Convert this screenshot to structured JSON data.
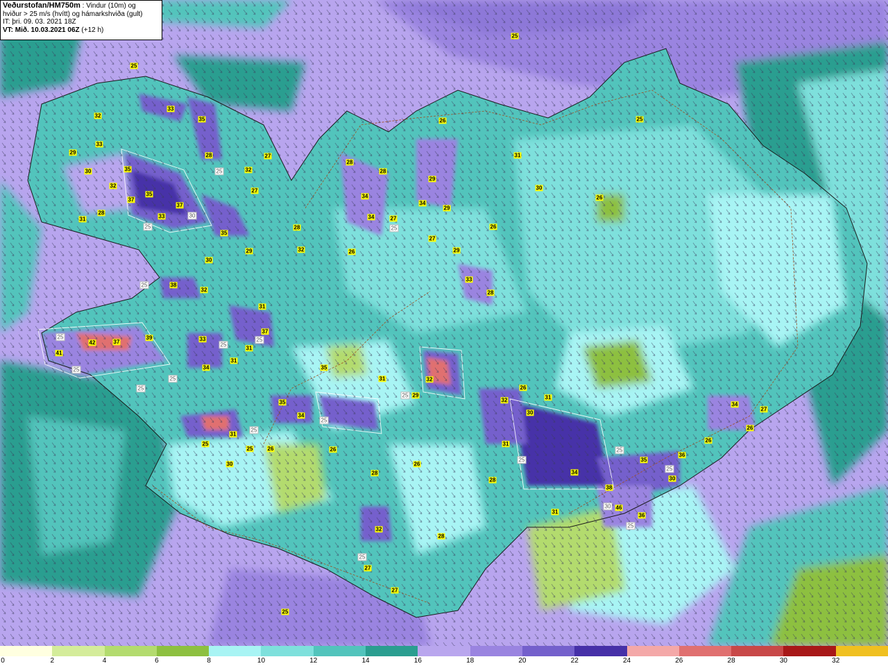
{
  "header": {
    "title": "Veðurstofan/HM750m",
    "subtitle_part1": " : Vindur (10m) og",
    "subtitle_part2": "hviður > 25 m/s (hvítt) og hámarkshviða (gult)",
    "it_line": "IT: þri. 09. 03. 2021 18Z",
    "vt_line": "VT: Mið. 10.03.2021 06Z",
    "vt_offset": " (+12 h)"
  },
  "colorbar": {
    "ticks": [
      "0",
      "2",
      "4",
      "6",
      "8",
      "10",
      "12",
      "14",
      "16",
      "18",
      "20",
      "22",
      "24",
      "26",
      "28",
      "30",
      "32"
    ],
    "colors": [
      "#ffffe0",
      "#d4ec9a",
      "#b3db6e",
      "#8dc040",
      "#a8f4f4",
      "#7ee0dc",
      "#52c4bc",
      "#2a9e90",
      "#b9a6ee",
      "#9a84e0",
      "#7460cc",
      "#4630a8",
      "#f4a8a8",
      "#e07070",
      "#c84848",
      "#a81818",
      "#f0c020"
    ]
  },
  "map": {
    "gust_labels_yellow": [
      {
        "v": "25"
      },
      {
        "v": "25"
      },
      {
        "v": "32"
      },
      {
        "v": "33"
      },
      {
        "v": "35"
      },
      {
        "v": "29"
      },
      {
        "v": "33"
      },
      {
        "v": "30"
      },
      {
        "v": "35"
      },
      {
        "v": "28"
      },
      {
        "v": "32"
      },
      {
        "v": "27"
      },
      {
        "v": "32"
      },
      {
        "v": "37"
      },
      {
        "v": "35"
      },
      {
        "v": "37"
      },
      {
        "v": "27"
      },
      {
        "v": "28"
      },
      {
        "v": "31"
      },
      {
        "v": "33"
      },
      {
        "v": "35"
      },
      {
        "v": "29"
      },
      {
        "v": "30"
      },
      {
        "v": "38"
      },
      {
        "v": "32"
      },
      {
        "v": "31"
      },
      {
        "v": "37"
      },
      {
        "v": "41"
      },
      {
        "v": "42"
      },
      {
        "v": "37"
      },
      {
        "v": "39"
      },
      {
        "v": "33"
      },
      {
        "v": "31"
      },
      {
        "v": "34"
      },
      {
        "v": "31"
      },
      {
        "v": "28"
      },
      {
        "v": "32"
      },
      {
        "v": "26"
      },
      {
        "v": "28"
      },
      {
        "v": "28"
      },
      {
        "v": "34"
      },
      {
        "v": "34"
      },
      {
        "v": "27"
      },
      {
        "v": "26"
      },
      {
        "v": "29"
      },
      {
        "v": "34"
      },
      {
        "v": "29"
      },
      {
        "v": "27"
      },
      {
        "v": "29"
      },
      {
        "v": "33"
      },
      {
        "v": "28"
      },
      {
        "v": "26"
      },
      {
        "v": "31"
      },
      {
        "v": "30"
      },
      {
        "v": "26"
      },
      {
        "v": "25"
      },
      {
        "v": "35"
      },
      {
        "v": "31"
      },
      {
        "v": "32"
      },
      {
        "v": "29"
      },
      {
        "v": "35"
      },
      {
        "v": "34"
      },
      {
        "v": "31"
      },
      {
        "v": "25"
      },
      {
        "v": "25"
      },
      {
        "v": "26"
      },
      {
        "v": "26"
      },
      {
        "v": "30"
      },
      {
        "v": "28"
      },
      {
        "v": "26"
      },
      {
        "v": "26"
      },
      {
        "v": "32"
      },
      {
        "v": "31"
      },
      {
        "v": "30"
      },
      {
        "v": "31"
      },
      {
        "v": "34"
      },
      {
        "v": "35"
      },
      {
        "v": "36"
      },
      {
        "v": "30"
      },
      {
        "v": "38"
      },
      {
        "v": "46"
      },
      {
        "v": "36"
      },
      {
        "v": "31"
      },
      {
        "v": "28"
      },
      {
        "v": "32"
      },
      {
        "v": "28"
      },
      {
        "v": "27"
      },
      {
        "v": "27"
      },
      {
        "v": "25"
      },
      {
        "v": "34"
      },
      {
        "v": "27"
      },
      {
        "v": "26"
      },
      {
        "v": "26"
      }
    ],
    "gust_labels_white": [
      {
        "v": "25"
      },
      {
        "v": "25"
      },
      {
        "v": "25"
      },
      {
        "v": "30"
      },
      {
        "v": "25"
      },
      {
        "v": "25"
      },
      {
        "v": "25"
      },
      {
        "v": "25"
      },
      {
        "v": "25"
      },
      {
        "v": "25"
      },
      {
        "v": "25"
      },
      {
        "v": "25"
      },
      {
        "v": "25"
      },
      {
        "v": "25"
      },
      {
        "v": "25"
      },
      {
        "v": "25"
      },
      {
        "v": "25"
      },
      {
        "v": "30"
      },
      {
        "v": "25"
      },
      {
        "v": "25"
      },
      {
        "v": "25"
      }
    ]
  }
}
